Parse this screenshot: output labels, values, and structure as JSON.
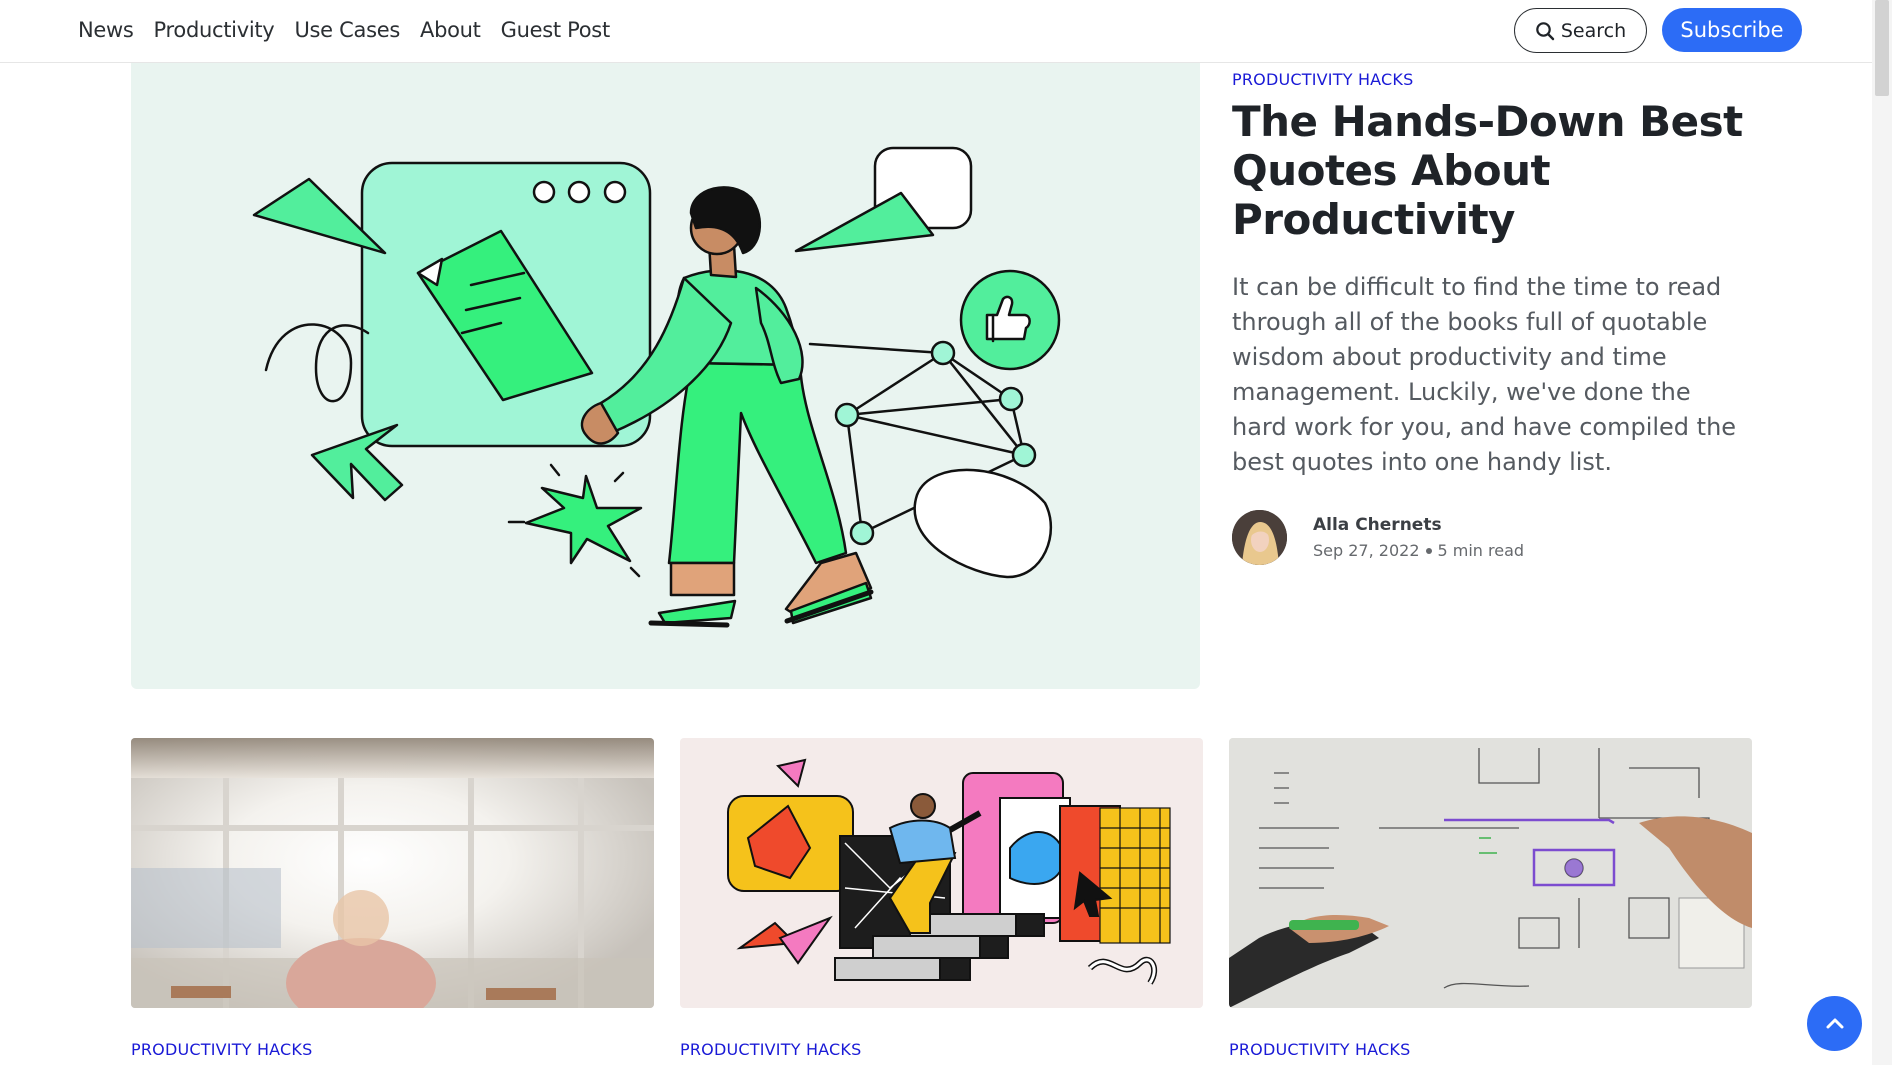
{
  "nav": {
    "items": [
      "News",
      "Productivity",
      "Use Cases",
      "About",
      "Guest Post"
    ],
    "search_label": "Search",
    "subscribe_label": "Subscribe"
  },
  "hero": {
    "tag": "PRODUCTIVITY HACKS",
    "title": "The Hands-Down Best Quotes About Productivity",
    "excerpt": "It can be difficult to find the time to read through all of the books full of quotable wisdom about productivity and time management. Luckily, we've done the hard work for you, and have compiled the best quotes into one handy list.",
    "author": "Alla Chernets",
    "date": "Sep 27, 2022",
    "read_time": "5 min read"
  },
  "cards": [
    {
      "tag": "PRODUCTIVITY HACKS"
    },
    {
      "tag": "PRODUCTIVITY HACKS"
    },
    {
      "tag": "PRODUCTIVITY HACKS"
    }
  ],
  "colors": {
    "accent": "#2c6cf6",
    "tag": "#1a1ad6",
    "hero_bg": "#e9f4f0",
    "illustration_green": "#35f07d",
    "illustration_mint": "#a0f5d6"
  },
  "icons": {
    "search": "search-icon",
    "back_to_top": "chevron-up-icon"
  }
}
